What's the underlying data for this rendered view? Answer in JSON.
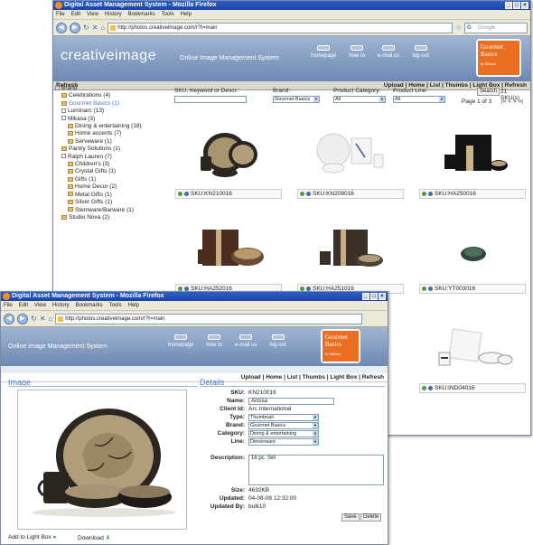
{
  "window1": {
    "title": "Digital Asset Management System - Mozilla Firefox",
    "menu": [
      "File",
      "Edit",
      "View",
      "History",
      "Bookmarks",
      "Tools",
      "Help"
    ],
    "url": "http://photos.creativeimage.com/r?t=main",
    "search_placeholder": "Google",
    "brand_logo": "creativeimage",
    "tagline": "Online Image Management System",
    "nav": [
      "homepage",
      "how to",
      "e-mail us",
      "log-out"
    ],
    "client_logo": "Gourmet Basics",
    "client_logo_sub": "by Mikasa",
    "toolbar": {
      "refresh": "Refresh",
      "links": "Upload | Home | List | Thumbs | Light Box | Refresh"
    },
    "tree": [
      {
        "label": "Brand",
        "level": 0,
        "type": "x"
      },
      {
        "label": "Celebrations (4)",
        "level": 1,
        "type": "f"
      },
      {
        "label": "Gourmet Basics (1)",
        "level": 1,
        "type": "f",
        "selected": true
      },
      {
        "label": "Luminarc (13)",
        "level": 1,
        "type": "x"
      },
      {
        "label": "Mikasa (3)",
        "level": 1,
        "type": "x"
      },
      {
        "label": "Dining & entertaining (18)",
        "level": 2,
        "type": "f"
      },
      {
        "label": "Home accents (7)",
        "level": 2,
        "type": "f"
      },
      {
        "label": "Serveware (1)",
        "level": 2,
        "type": "f"
      },
      {
        "label": "Pantry Solutions (1)",
        "level": 1,
        "type": "f"
      },
      {
        "label": "Ralph Lauren (7)",
        "level": 1,
        "type": "x"
      },
      {
        "label": "Children's (3)",
        "level": 2,
        "type": "f"
      },
      {
        "label": "Crystal Gifts (1)",
        "level": 2,
        "type": "f"
      },
      {
        "label": "Gifts (1)",
        "level": 2,
        "type": "f"
      },
      {
        "label": "Home Decor (2)",
        "level": 2,
        "type": "f"
      },
      {
        "label": "Metal Gifts (1)",
        "level": 2,
        "type": "f"
      },
      {
        "label": "Silver Gifts (1)",
        "level": 2,
        "type": "f"
      },
      {
        "label": "Stemware/Barware (1)",
        "level": 2,
        "type": "f"
      },
      {
        "label": "Studio Nova (2)",
        "level": 1,
        "type": "f"
      }
    ],
    "filters": {
      "sku_label": "SKU, Keyword or Descr.:",
      "brand_label": "Brand:",
      "brand_value": "Gourmet Basics",
      "category_label": "Product Category:",
      "category_value": "All",
      "line_label": "Product Line:",
      "line_value": "All",
      "search_button": "Search",
      "count": "21 SKU(s)",
      "page": "Page 1 of 3",
      "pager": "|< < > >|"
    },
    "thumbs": [
      {
        "sku": "SKU:KN210016",
        "style": "dark"
      },
      {
        "sku": "SKU:KN209016",
        "style": "white"
      },
      {
        "sku": "SKU:HA250016",
        "style": "black"
      },
      {
        "sku": "SKU:HA252016",
        "style": "brown"
      },
      {
        "sku": "SKU:HA251016",
        "style": "olive"
      },
      {
        "sku": "SKU:YT003016",
        "style": "green"
      },
      {
        "sku": "SKU:IND04016",
        "style": "whitesq"
      }
    ]
  },
  "window2": {
    "title": "Digital Asset Management System - Mozilla Firefox",
    "menu": [
      "File",
      "Edit",
      "View",
      "History",
      "Bookmarks",
      "Tools",
      "Help"
    ],
    "url": "http://photos.creativeimage.com/r?t=main",
    "tagline": "Online Image Management System",
    "nav": [
      "homepage",
      "how to",
      "e-mail us",
      "log-out"
    ],
    "client_logo": "Gourmet Basics",
    "client_logo_sub": "by Mikasa",
    "toolbar_links": "Upload | Home | List | Thumbs | Light Box | Refresh",
    "image_heading": "Image",
    "details_heading": "Details",
    "details": [
      {
        "label": "SKU:",
        "value": "KN210016",
        "kind": "text"
      },
      {
        "label": "Name:",
        "value": "Anissa",
        "kind": "input"
      },
      {
        "label": "Client Id:",
        "value": "Arc International",
        "kind": "text"
      },
      {
        "label": "Type:",
        "value": "Thumbnail",
        "kind": "select"
      },
      {
        "label": "Brand:",
        "value": "Gourmet Basics",
        "kind": "select"
      },
      {
        "label": "Category:",
        "value": "Dining & entertaining",
        "kind": "select"
      },
      {
        "label": "Line:",
        "value": "Dinnerware",
        "kind": "select"
      }
    ],
    "description_label": "Description:",
    "description_value": "16 pc. Set",
    "size_label": "Size:",
    "size_value": "4632KB",
    "updated_label": "Updated:",
    "updated_value": "04-08-08 12:32:00",
    "updated_by_label": "Updated By:",
    "updated_by_value": "bulk10",
    "save": "Save",
    "delete": "Delete",
    "add_lightbox": "Add to Light Box",
    "download": "Download"
  }
}
